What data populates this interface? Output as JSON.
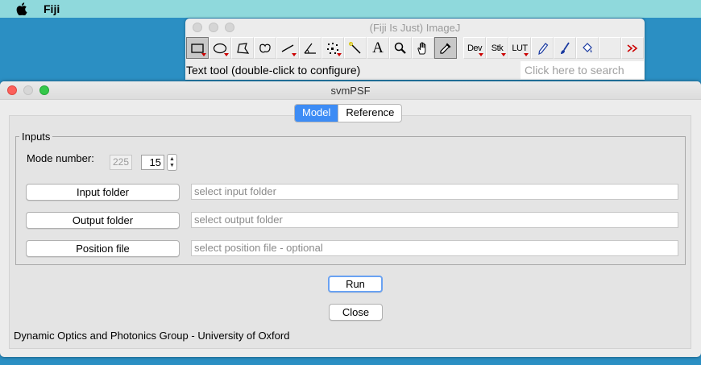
{
  "menubar": {
    "app_name": "Fiji"
  },
  "imagej": {
    "title": "(Fiji Is Just) ImageJ",
    "tools": {
      "dev": "Dev",
      "stk": "Stk",
      "lut": "LUT",
      "text_a": "A"
    },
    "status": "Text tool (double-click to configure)",
    "search_placeholder": "Click here to search"
  },
  "svm": {
    "title": "svmPSF",
    "tabs": [
      {
        "label": "Model",
        "active": true
      },
      {
        "label": "Reference",
        "active": false
      }
    ],
    "inputs_legend": "Inputs",
    "mode_label": "Mode number:",
    "mode_total": "225",
    "mode_value": "15",
    "rows": [
      {
        "button": "Input folder",
        "placeholder": "select input folder"
      },
      {
        "button": "Output folder",
        "placeholder": "select output folder"
      },
      {
        "button": "Position file",
        "placeholder": "select position file - optional"
      }
    ],
    "run_label": "Run",
    "close_label": "Close",
    "footer": "Dynamic Optics and Photonics Group - University of Oxford"
  },
  "colors": {
    "desktop": "#2b8fc3",
    "menubar": "#8fd9dc",
    "accent": "#3d8cf5",
    "close_light": "#fc605b",
    "max_light": "#34c84a"
  }
}
